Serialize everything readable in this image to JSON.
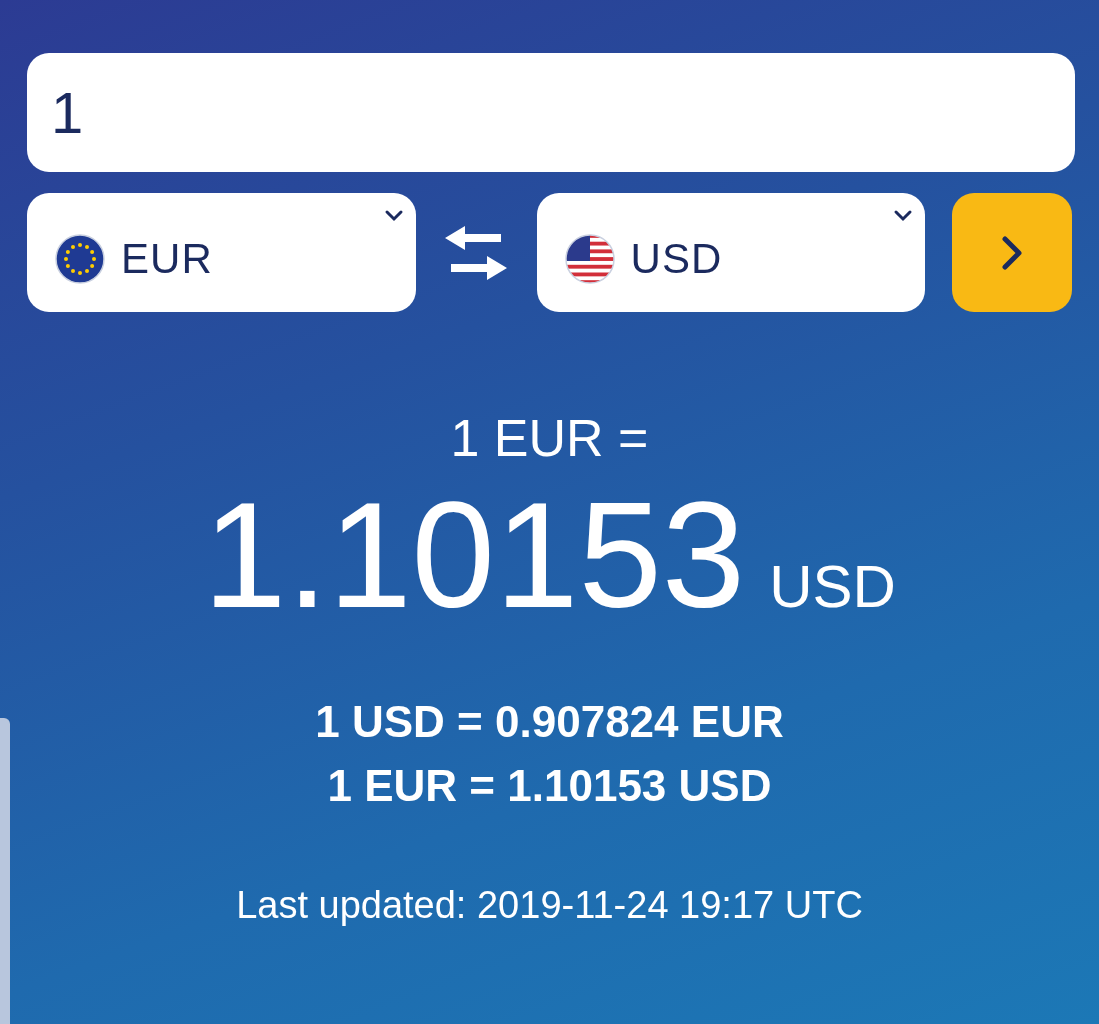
{
  "amount": {
    "value": "1"
  },
  "from_currency": {
    "code": "EUR"
  },
  "to_currency": {
    "code": "USD"
  },
  "result": {
    "base": "1 EUR =",
    "value": "1.10153",
    "currency": "USD"
  },
  "rates": [
    "1 USD = 0.907824 EUR",
    "1 EUR = 1.10153 USD"
  ],
  "last_updated": "Last updated: 2019-11-24 19:17 UTC"
}
